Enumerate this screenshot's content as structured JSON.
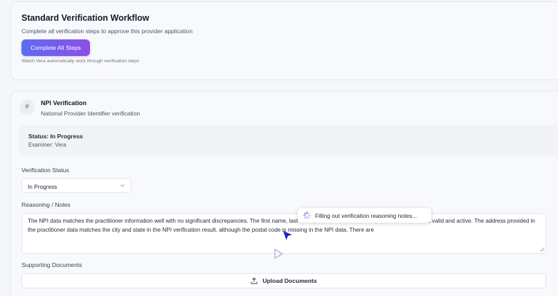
{
  "workflow": {
    "title": "Standard Verification Workflow",
    "subtitle": "Complete all verification steps to approve this provider application",
    "complete_button": "Complete All Steps",
    "hint": "Watch Vera automatically work through verification steps"
  },
  "npi_section": {
    "icon_glyph": "#",
    "title": "NPI Verification",
    "description": "National Provider Identifier verification",
    "status": "Status: In Progress",
    "examiner": "Examiner: Vera",
    "verification_status_label": "Verification Status",
    "verification_status_value": "In Progress",
    "reasoning_label": "Reasoning / Notes",
    "reasoning_text": "The NPI data matches the practitioner information well with no significant discrepancies. The first name, last name, and NPI number match, and the NPI status is valid and active. The address provided in the practitioner data matches the city and state in the NPI verification result, although the postal code is missing in the NPI data. There are",
    "supporting_docs_label": "Supporting Documents",
    "upload_button": "Upload Documents"
  },
  "overlay": {
    "tooltip_text": "Filling out verification reasoning notes..."
  },
  "colors": {
    "button_gradient_start": "#5b6cf0",
    "button_gradient_end": "#8f4ee6",
    "cursor": "#1d23c8",
    "spinner": "#3b4bd8"
  }
}
